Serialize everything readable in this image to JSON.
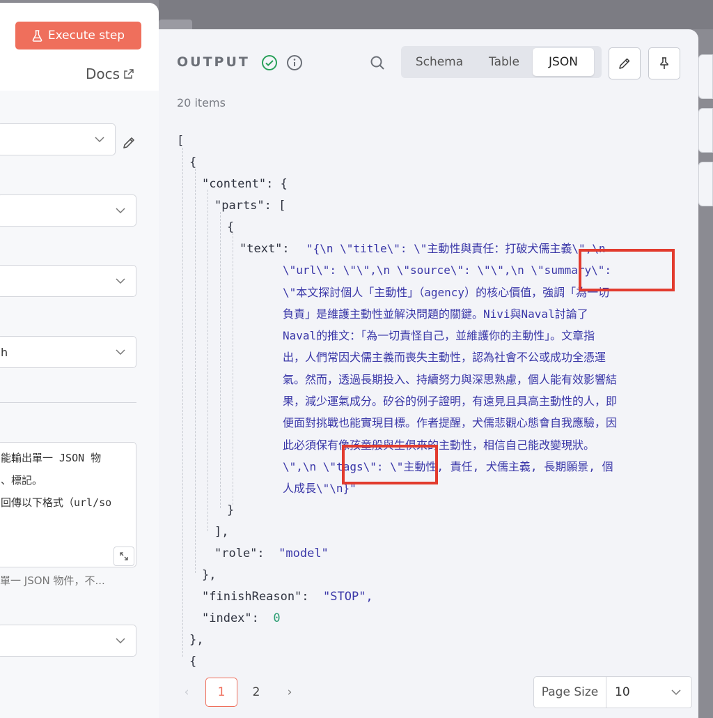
{
  "left_panel": {
    "execute_label": "Execute step",
    "docs_label": "Docs",
    "select_3_value": "h",
    "textarea_lines": [
      "能輸出單一 JSON 物",
      "、標記。",
      "",
      "回傳以下格式（url/so"
    ],
    "hint_text": "單一 JSON 物件，不..."
  },
  "output": {
    "title": "OUTPUT",
    "tabs": [
      "Schema",
      "Table",
      "JSON"
    ],
    "active_tab": "JSON",
    "items_count": "20 items",
    "json_lines": {
      "open_bracket": "[",
      "open_brace": "{",
      "content_key": "\"content\": {",
      "parts_key": "\"parts\": [",
      "parts_open": "{",
      "text_key": "\"text\":",
      "parts_close": "}",
      "parts_end": "],",
      "role_key": "\"role\":",
      "role_val": "\"model\"",
      "content_close": "},",
      "finish_key": "\"finishReason\":",
      "finish_val": "\"STOP\",",
      "index_key": "\"index\":",
      "index_val": "0",
      "item_close": "},",
      "next_open": "{"
    },
    "text_value_lines": [
      "\"{\\n  \\\"title\\\": \\\"主動性與責任：打破犬儒主義\\\",\\n",
      "\\\"url\\\": \\\"\\\",\\n  \\\"source\\\": \\\"\\\",\\n  \\\"summary\\\":",
      "\\\"本文探討個人「主動性」（agency）的核心價值，強調「為一切",
      "負責」是維護主動性並解決問題的關鍵。Nivi與Naval討論了",
      "Naval的推文：「為一切責怪自己，並維護你的主動性」。文章指",
      "出，人們常因犬儒主義而喪失主動性，認為社會不公或成功全憑運",
      "氣。然而，透過長期投入、持續努力與深思熟慮，個人能有效影響結",
      "果，減少運氣成分。矽谷的例子證明，有遠見且具高主動性的人，即",
      "便面對挑戰也能實現目標。作者提醒，犬儒悲觀心態會自我應驗，因",
      "此必須保有像孩童般與生俱來的主動性，相信自己能改變現狀。",
      "\\\",\\n  \\\"tags\\\": \\\"主動性, 責任, 犬儒主義, 長期願景, 個",
      "人成長\\\"\\n}\""
    ],
    "pagination": {
      "prev": "‹",
      "pages": [
        "1",
        "2"
      ],
      "current": "1",
      "next": "›",
      "page_size_label": "Page Size",
      "page_size_value": "10"
    }
  },
  "colors": {
    "accent": "#ef6f5c",
    "string": "#3a37a8",
    "number": "#2a9d72",
    "highlight": "#e23b2e",
    "success": "#2aa05a"
  }
}
